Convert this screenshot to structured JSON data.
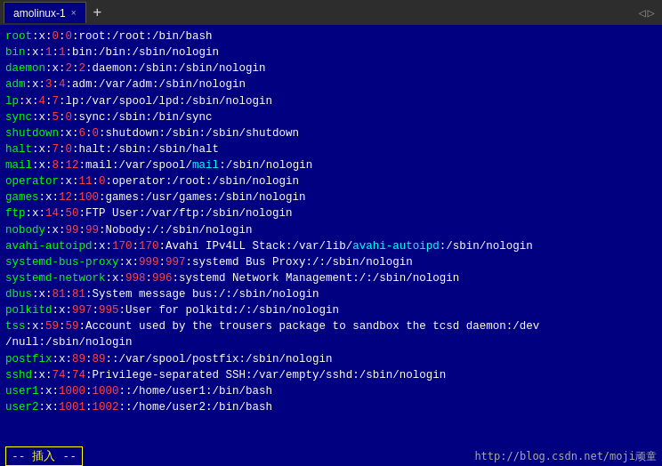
{
  "tab": {
    "label": "amolinux-1",
    "close": "×",
    "add": "+"
  },
  "nav": {
    "left": "◁",
    "right": "▷"
  },
  "terminal": {
    "lines": [
      {
        "id": 1,
        "parts": [
          {
            "text": "root",
            "color": "green"
          },
          {
            "text": ":x:",
            "color": "white"
          },
          {
            "text": "0",
            "color": "red"
          },
          {
            "text": ":",
            "color": "white"
          },
          {
            "text": "0",
            "color": "red"
          },
          {
            "text": ":root:/root:/bin/bash",
            "color": "white"
          }
        ]
      },
      {
        "id": 2,
        "parts": [
          {
            "text": "bin",
            "color": "green"
          },
          {
            "text": ":x:",
            "color": "white"
          },
          {
            "text": "1",
            "color": "red"
          },
          {
            "text": ":",
            "color": "white"
          },
          {
            "text": "1",
            "color": "red"
          },
          {
            "text": ":bin:/bin:/sbin/nologin",
            "color": "white"
          }
        ]
      },
      {
        "id": 3,
        "parts": [
          {
            "text": "daemon",
            "color": "green"
          },
          {
            "text": ":x:",
            "color": "white"
          },
          {
            "text": "2",
            "color": "red"
          },
          {
            "text": ":",
            "color": "white"
          },
          {
            "text": "2",
            "color": "red"
          },
          {
            "text": ":daemon:/sbin:/sbin/nologin",
            "color": "white"
          }
        ]
      },
      {
        "id": 4,
        "parts": [
          {
            "text": "adm",
            "color": "green"
          },
          {
            "text": ":x:",
            "color": "white"
          },
          {
            "text": "3",
            "color": "red"
          },
          {
            "text": ":",
            "color": "white"
          },
          {
            "text": "4",
            "color": "red"
          },
          {
            "text": ":adm:/var/adm:/sbin/nologin",
            "color": "white"
          }
        ]
      },
      {
        "id": 5,
        "parts": [
          {
            "text": "lp",
            "color": "green"
          },
          {
            "text": ":x:",
            "color": "white"
          },
          {
            "text": "4",
            "color": "red"
          },
          {
            "text": ":",
            "color": "white"
          },
          {
            "text": "7",
            "color": "red"
          },
          {
            "text": ":lp:/var/spool/lpd:/sbin/nologin",
            "color": "white"
          }
        ]
      },
      {
        "id": 6,
        "parts": [
          {
            "text": "sync",
            "color": "green"
          },
          {
            "text": ":x:",
            "color": "white"
          },
          {
            "text": "5",
            "color": "red"
          },
          {
            "text": ":",
            "color": "white"
          },
          {
            "text": "0",
            "color": "red"
          },
          {
            "text": ":sync:/sbin:/bin/sync",
            "color": "white"
          }
        ]
      },
      {
        "id": 7,
        "parts": [
          {
            "text": "shutdown",
            "color": "green"
          },
          {
            "text": ":x:",
            "color": "white"
          },
          {
            "text": "6",
            "color": "red"
          },
          {
            "text": ":",
            "color": "white"
          },
          {
            "text": "0",
            "color": "red"
          },
          {
            "text": ":shutdown:/sbin:/sbin/shutdown",
            "color": "white"
          }
        ]
      },
      {
        "id": 8,
        "parts": [
          {
            "text": "halt",
            "color": "green"
          },
          {
            "text": ":x:",
            "color": "white"
          },
          {
            "text": "7",
            "color": "red"
          },
          {
            "text": ":",
            "color": "white"
          },
          {
            "text": "0",
            "color": "red"
          },
          {
            "text": ":halt:/sbin:/sbin/halt",
            "color": "white"
          }
        ]
      },
      {
        "id": 9,
        "parts": [
          {
            "text": "mail",
            "color": "green"
          },
          {
            "text": ":x:",
            "color": "white"
          },
          {
            "text": "8",
            "color": "red"
          },
          {
            "text": ":",
            "color": "white"
          },
          {
            "text": "12",
            "color": "red"
          },
          {
            "text": ":mail:/var/spool/",
            "color": "white"
          },
          {
            "text": "mail",
            "color": "cyan"
          },
          {
            "text": ":/sbin/nologin",
            "color": "white"
          }
        ]
      },
      {
        "id": 10,
        "parts": [
          {
            "text": "operator",
            "color": "green"
          },
          {
            "text": ":x:",
            "color": "white"
          },
          {
            "text": "11",
            "color": "red"
          },
          {
            "text": ":",
            "color": "white"
          },
          {
            "text": "0",
            "color": "red"
          },
          {
            "text": ":operator:/root:/sbin/nologin",
            "color": "white"
          }
        ]
      },
      {
        "id": 11,
        "parts": [
          {
            "text": "games",
            "color": "green"
          },
          {
            "text": ":x:",
            "color": "white"
          },
          {
            "text": "12",
            "color": "red"
          },
          {
            "text": ":",
            "color": "white"
          },
          {
            "text": "100",
            "color": "red"
          },
          {
            "text": ":games:/usr/games:/sbin/nologin",
            "color": "white"
          }
        ]
      },
      {
        "id": 12,
        "parts": [
          {
            "text": "ftp",
            "color": "green"
          },
          {
            "text": ":x:",
            "color": "white"
          },
          {
            "text": "14",
            "color": "red"
          },
          {
            "text": ":",
            "color": "white"
          },
          {
            "text": "50",
            "color": "red"
          },
          {
            "text": ":FTP User:/var/ftp:/sbin/nologin",
            "color": "white"
          }
        ]
      },
      {
        "id": 13,
        "parts": [
          {
            "text": "nobody",
            "color": "green"
          },
          {
            "text": ":x:",
            "color": "white"
          },
          {
            "text": "99",
            "color": "red"
          },
          {
            "text": ":",
            "color": "white"
          },
          {
            "text": "99",
            "color": "red"
          },
          {
            "text": ":Nobody:/:/sbin/nologin",
            "color": "white"
          }
        ]
      },
      {
        "id": 14,
        "parts": [
          {
            "text": "avahi-autoipd",
            "color": "green"
          },
          {
            "text": ":x:",
            "color": "white"
          },
          {
            "text": "170",
            "color": "red"
          },
          {
            "text": ":",
            "color": "white"
          },
          {
            "text": "170",
            "color": "red"
          },
          {
            "text": ":Avahi IPv4LL Stack:/var/lib/",
            "color": "white"
          },
          {
            "text": "avahi-autoipd",
            "color": "cyan"
          },
          {
            "text": ":/sbin/nologin",
            "color": "white"
          }
        ]
      },
      {
        "id": 15,
        "parts": [
          {
            "text": "systemd-bus-proxy",
            "color": "green"
          },
          {
            "text": ":x:",
            "color": "white"
          },
          {
            "text": "999",
            "color": "red"
          },
          {
            "text": ":",
            "color": "white"
          },
          {
            "text": "997",
            "color": "red"
          },
          {
            "text": ":systemd Bus Proxy:/:/sbin/nologin",
            "color": "white"
          }
        ]
      },
      {
        "id": 16,
        "parts": [
          {
            "text": "systemd-network",
            "color": "green"
          },
          {
            "text": ":x:",
            "color": "white"
          },
          {
            "text": "998",
            "color": "red"
          },
          {
            "text": ":",
            "color": "white"
          },
          {
            "text": "996",
            "color": "red"
          },
          {
            "text": ":systemd Network Management:/:/sbin/nologin",
            "color": "white"
          }
        ]
      },
      {
        "id": 17,
        "parts": [
          {
            "text": "dbus",
            "color": "green"
          },
          {
            "text": ":x:",
            "color": "white"
          },
          {
            "text": "81",
            "color": "red"
          },
          {
            "text": ":",
            "color": "white"
          },
          {
            "text": "81",
            "color": "red"
          },
          {
            "text": ":System message bus:/:/sbin/nologin",
            "color": "white"
          }
        ]
      },
      {
        "id": 18,
        "parts": [
          {
            "text": "polkitd",
            "color": "green"
          },
          {
            "text": ":x:",
            "color": "white"
          },
          {
            "text": "997",
            "color": "red"
          },
          {
            "text": ":",
            "color": "white"
          },
          {
            "text": "995",
            "color": "red"
          },
          {
            "text": ":User for polkitd:/:/sbin/nologin",
            "color": "white"
          }
        ]
      },
      {
        "id": 19,
        "parts": [
          {
            "text": "tss",
            "color": "green"
          },
          {
            "text": ":x:",
            "color": "white"
          },
          {
            "text": "59",
            "color": "red"
          },
          {
            "text": ":",
            "color": "white"
          },
          {
            "text": "59",
            "color": "red"
          },
          {
            "text": ":Account used by the trousers package to sandbox the tcsd daemon:/dev",
            "color": "white"
          }
        ]
      },
      {
        "id": 20,
        "parts": [
          {
            "text": "/null:/sbin/nologin",
            "color": "white"
          }
        ]
      },
      {
        "id": 21,
        "parts": [
          {
            "text": "postfix",
            "color": "green"
          },
          {
            "text": ":x:",
            "color": "white"
          },
          {
            "text": "89",
            "color": "red"
          },
          {
            "text": ":",
            "color": "white"
          },
          {
            "text": "89",
            "color": "red"
          },
          {
            "text": "::/var/spool/postfix:/sbin/nologin",
            "color": "white"
          }
        ]
      },
      {
        "id": 22,
        "parts": [
          {
            "text": "sshd",
            "color": "green"
          },
          {
            "text": ":x:",
            "color": "white"
          },
          {
            "text": "74",
            "color": "red"
          },
          {
            "text": ":",
            "color": "white"
          },
          {
            "text": "74",
            "color": "red"
          },
          {
            "text": ":Privilege-separated SSH:/var/empty/sshd:/sbin/nologin",
            "color": "white"
          }
        ]
      },
      {
        "id": 23,
        "parts": [
          {
            "text": "user1",
            "color": "green"
          },
          {
            "text": ":x:",
            "color": "white"
          },
          {
            "text": "1000",
            "color": "red"
          },
          {
            "text": ":",
            "color": "white"
          },
          {
            "text": "1000",
            "color": "red"
          },
          {
            "text": "::/home/user1:/bin/bash",
            "color": "white"
          }
        ]
      },
      {
        "id": 24,
        "parts": [
          {
            "text": "user2",
            "color": "green"
          },
          {
            "text": ":x:",
            "color": "white"
          },
          {
            "text": "1001",
            "color": "red"
          },
          {
            "text": ":",
            "color": "white"
          },
          {
            "text": "1002",
            "color": "red"
          },
          {
            "text": "::/home/user2:/bin/bash",
            "color": "white"
          }
        ]
      }
    ]
  },
  "statusbar": {
    "insert_label": "-- 插入 --",
    "blog_url": "http://blog.csdn.net/moji顽童"
  }
}
